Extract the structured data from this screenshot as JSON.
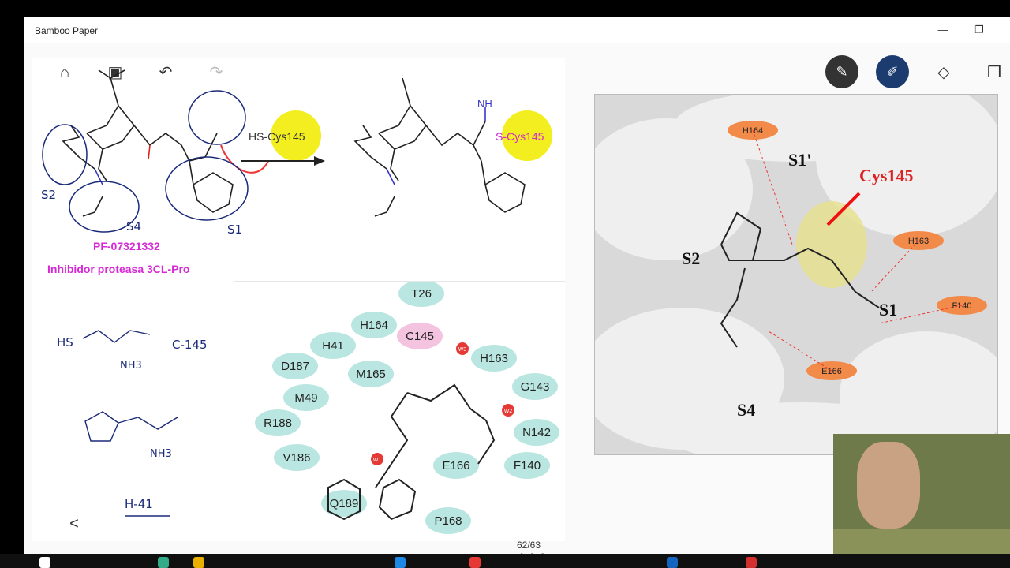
{
  "app": {
    "title": "Bamboo Paper"
  },
  "window_controls": {
    "minimize": "—",
    "restore": "❐"
  },
  "toolbar_left": {
    "home": "⌂",
    "image": "▣",
    "undo": "↶",
    "redo": "↷"
  },
  "toolbar_right": {
    "pen": "pen-icon",
    "marker": "brush-icon",
    "eraser": "eraser-icon",
    "copy": "copy-icon"
  },
  "chem_top": {
    "reagent": "HS-Cys145",
    "product_cys": "S-Cys145",
    "imine": "NH",
    "name": "PF-07321332",
    "subtitle": "Inhibidor proteasa 3CL-Pro",
    "ann_s2": "S2",
    "ann_s4": "S4",
    "ann_s1": "S1"
  },
  "handnotes": {
    "hs": "HS",
    "nh3_a": "NH3",
    "c145": "C-145",
    "nh3_b": "NH3",
    "h41": "H-41"
  },
  "interaction_map": {
    "residues": [
      "T26",
      "H164",
      "C145",
      "H41",
      "H163",
      "D187",
      "M165",
      "G143",
      "M49",
      "N142",
      "R188",
      "E166",
      "F140",
      "V186",
      "Q189",
      "P168"
    ],
    "waters": [
      "W3",
      "W2",
      "W1"
    ]
  },
  "protein": {
    "labels": [
      "S1'",
      "Cys145",
      "S2",
      "S1",
      "S4"
    ],
    "residues": [
      "H164",
      "H163",
      "F140",
      "E166"
    ]
  },
  "page": {
    "counter": "62/63",
    "prev": "<",
    "more": "• • •"
  }
}
